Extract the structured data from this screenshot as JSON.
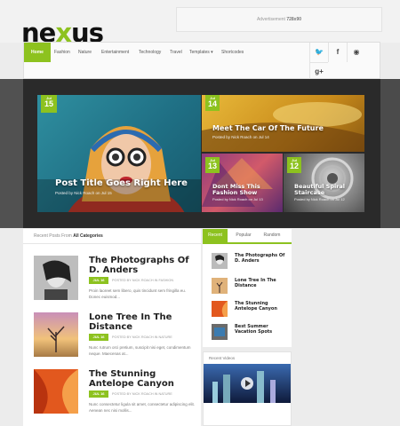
{
  "logo": {
    "pre": "ne",
    "x": "x",
    "post": "us"
  },
  "ad": {
    "text": "Advertisement",
    "size": "728x90"
  },
  "nav": {
    "items": [
      "Home",
      "Fashion",
      "Nature",
      "Entertainment",
      "Technology",
      "Travel",
      "Templates ▾",
      "Shortcodes"
    ],
    "active": "Home"
  },
  "social": {
    "twitter": "🐦",
    "facebook": "f",
    "rss": "◉",
    "gplus": "g+"
  },
  "featured": {
    "main": {
      "month": "Jul",
      "day": "15",
      "title": "Post Title Goes Right Here",
      "meta": "Posted by Nick Roach on Jul 15"
    },
    "top_right": {
      "month": "Jul",
      "day": "14",
      "title": "Meet The Car Of The Future",
      "meta": "Posted by Nick Roach on Jul 14"
    },
    "bottom_left": {
      "month": "Jul",
      "day": "13",
      "title": "Dont Miss This Fashion Show",
      "meta": "Posted by Nick Roach on Jul 13"
    },
    "bottom_right": {
      "month": "Jul",
      "day": "12",
      "title": "Beautiful Spiral Staircase",
      "meta": "Posted by Nick Roach on Jul 12"
    }
  },
  "recent_header": {
    "prefix": "Recent Posts From",
    "category": "All Categories"
  },
  "posts": [
    {
      "title": "The Photographs Of D. Anders",
      "date": "JUL 16",
      "meta": "POSTED BY NICK ROACH IN FASHION",
      "excerpt": "Proin laoreet sem libero, quis tincidunt sem fringilla eu. Donec euismod..."
    },
    {
      "title": "Lone Tree In The Distance",
      "date": "JUL 16",
      "meta": "POSTED BY NICK ROACH IN NATURE",
      "excerpt": "Nunc rutrum orci pretium, suscipit nisi eget, condimentum neque. Maecenas at..."
    },
    {
      "title": "The Stunning Antelope Canyon",
      "date": "JUL 16",
      "meta": "POSTED BY NICK ROACH IN NATURE",
      "excerpt": "Nunc consectetur ligula sit amet, consectetur adipiscing elit. Aenean nec nisi mollis..."
    }
  ],
  "sidebar_tabs": [
    "Recent",
    "Popular",
    "Random"
  ],
  "sidebar_items": [
    {
      "title": "The Photographs Of D. Anders"
    },
    {
      "title": "Lone Tree In The Distance"
    },
    {
      "title": "The Stunning Antelope Canyon"
    },
    {
      "title": "Best Summer Vacation Spots"
    }
  ],
  "videos": {
    "heading": "Recent Videos"
  },
  "colors": {
    "accent": "#8dc21f"
  }
}
